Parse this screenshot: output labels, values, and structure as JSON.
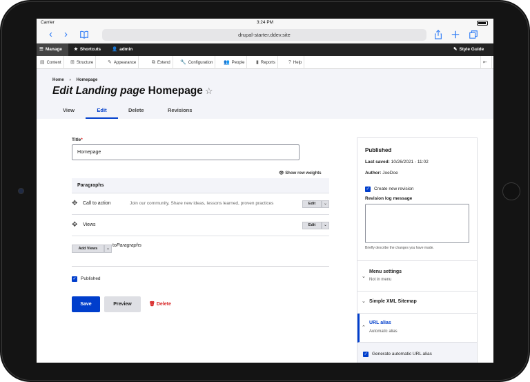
{
  "status_bar": {
    "carrier": "Carrier",
    "time": "3:24 PM"
  },
  "browser": {
    "url": "drupal-starter.ddev.site",
    "back_icon": "chevron-left-icon",
    "forward_icon": "chevron-right-icon"
  },
  "toolbar": {
    "manage": "Manage",
    "shortcuts": "Shortcuts",
    "user": "admin",
    "style_guide": "Style Guide"
  },
  "admin_menu": [
    "Content",
    "Structure",
    "Appearance",
    "Extend",
    "Configuration",
    "People",
    "Reports",
    "Help"
  ],
  "breadcrumb": {
    "home": "Home",
    "sep": "›",
    "current": "Homepage"
  },
  "page": {
    "title_prefix": "Edit Landing page",
    "title_name": "Homepage"
  },
  "tabs": [
    "View",
    "Edit",
    "Delete",
    "Revisions"
  ],
  "form": {
    "title_label": "Title",
    "required_mark": "*",
    "title_value": "Homepage",
    "row_weights": "Show row weights",
    "paragraphs_label": "Paragraphs",
    "paragraphs": [
      {
        "name": "Call to action",
        "summary": "Join our community, Share new ideas, lessons learned, proven practices",
        "edit": "Edit"
      },
      {
        "name": "Views",
        "summary": "",
        "edit": "Edit"
      }
    ],
    "add_button": "Add Views",
    "to_prefix": "to",
    "to_target": "Paragraphs",
    "published_label": "Published",
    "save": "Save",
    "preview": "Preview",
    "delete": "Delete"
  },
  "sidebar": {
    "status": "Published",
    "last_saved_label": "Last saved:",
    "last_saved_value": "10/26/2021 - 11:02",
    "author_label": "Author:",
    "author_value": "JoeDoe",
    "create_revision": "Create new revision",
    "revision_log_label": "Revision log message",
    "revision_hint": "Briefly describe the changes you have made.",
    "menu_settings": "Menu settings",
    "menu_settings_sub": "Not in menu",
    "sitemap": "Simple XML Sitemap",
    "url_alias": "URL alias",
    "url_alias_sub": "Automatic alias",
    "generate_alias": "Generate automatic URL alias"
  },
  "colors": {
    "accent": "#003ecc",
    "danger": "#d72222",
    "toolbar": "#232323"
  }
}
